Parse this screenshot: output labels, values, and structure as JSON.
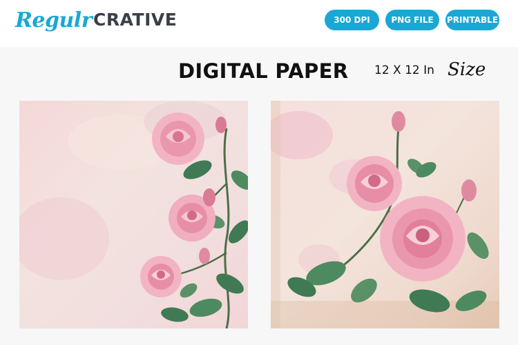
{
  "brand": {
    "script": "Regulr",
    "bold": "CRATIVE"
  },
  "badges": [
    "300 DPI",
    "PNG FILE",
    "PRINTABLE"
  ],
  "title": "DIGITAL PAPER",
  "size": {
    "dimensions": "12 X 12 In",
    "word": "Size"
  },
  "colors": {
    "accent": "#1aa7d6",
    "dark": "#3a4048",
    "rose": "#e98aa7",
    "leaf": "#3f7a55"
  },
  "previews": [
    {
      "name": "rose-paper-left",
      "theme": "climbing pink roses on right edge"
    },
    {
      "name": "rose-paper-right",
      "theme": "large pink roses with buds"
    }
  ]
}
